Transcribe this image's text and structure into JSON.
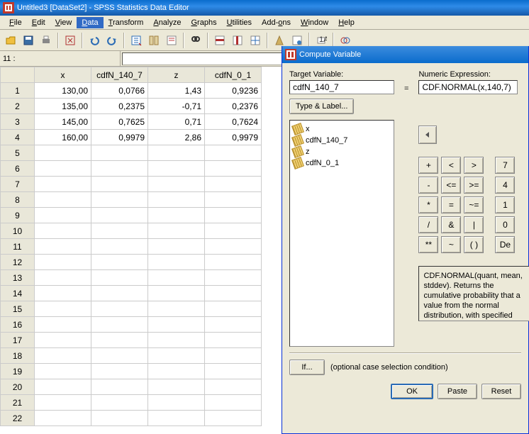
{
  "app": {
    "title": "Untitled3 [DataSet2] - SPSS Statistics Data Editor"
  },
  "menu": {
    "file": "File",
    "edit": "Edit",
    "view": "View",
    "data": "Data",
    "transform": "Transform",
    "analyze": "Analyze",
    "graphs": "Graphs",
    "utilities": "Utilities",
    "addons": "Add-ons",
    "window": "Window",
    "help": "Help"
  },
  "formula": {
    "ref": "11 :"
  },
  "columns": [
    "x",
    "cdfN_140_7",
    "z",
    "cdfN_0_1"
  ],
  "rows": [
    {
      "n": "1",
      "x": "130,00",
      "c1": "0,0766",
      "z": "1,43",
      "c2": "0,9236"
    },
    {
      "n": "2",
      "x": "135,00",
      "c1": "0,2375",
      "z": "-0,71",
      "c2": "0,2376"
    },
    {
      "n": "3",
      "x": "145,00",
      "c1": "0,7625",
      "z": "0,71",
      "c2": "0,7624"
    },
    {
      "n": "4",
      "x": "160,00",
      "c1": "0,9979",
      "z": "2,86",
      "c2": "0,9979"
    }
  ],
  "emptyRows": [
    "5",
    "6",
    "7",
    "8",
    "9",
    "10",
    "11",
    "12",
    "13",
    "14",
    "15",
    "16",
    "17",
    "18",
    "19",
    "20",
    "21",
    "22"
  ],
  "dialog": {
    "title": "Compute Variable",
    "targetLabel": "Target Variable:",
    "targetValue": "cdfN_140_7",
    "typeLabel": "Type & Label...",
    "eq": "=",
    "exprLabel": "Numeric Expression:",
    "exprValue": "CDF.NORMAL(x,140,7)",
    "vars": [
      "x",
      "cdfN_140_7",
      "z",
      "cdfN_0_1"
    ],
    "calc": {
      "r1": [
        "+",
        "<",
        ">",
        "7"
      ],
      "r2": [
        "-",
        "<=",
        ">=",
        "4"
      ],
      "r3": [
        "*",
        "=",
        "~=",
        "1"
      ],
      "r4": [
        "/",
        "&",
        "|",
        "0"
      ],
      "r5": [
        "**",
        "~",
        "( )"
      ],
      "del": "De"
    },
    "desc": "CDF.NORMAL(quant, mean, stddev). Numeric. Returns the cumulative probability that a value from the normal distribution, with specified mean and standard deviation, will be less than quant.",
    "ifBtn": "If...",
    "ifText": "(optional case selection condition)",
    "ok": "OK",
    "paste": "Paste",
    "reset": "Reset"
  }
}
